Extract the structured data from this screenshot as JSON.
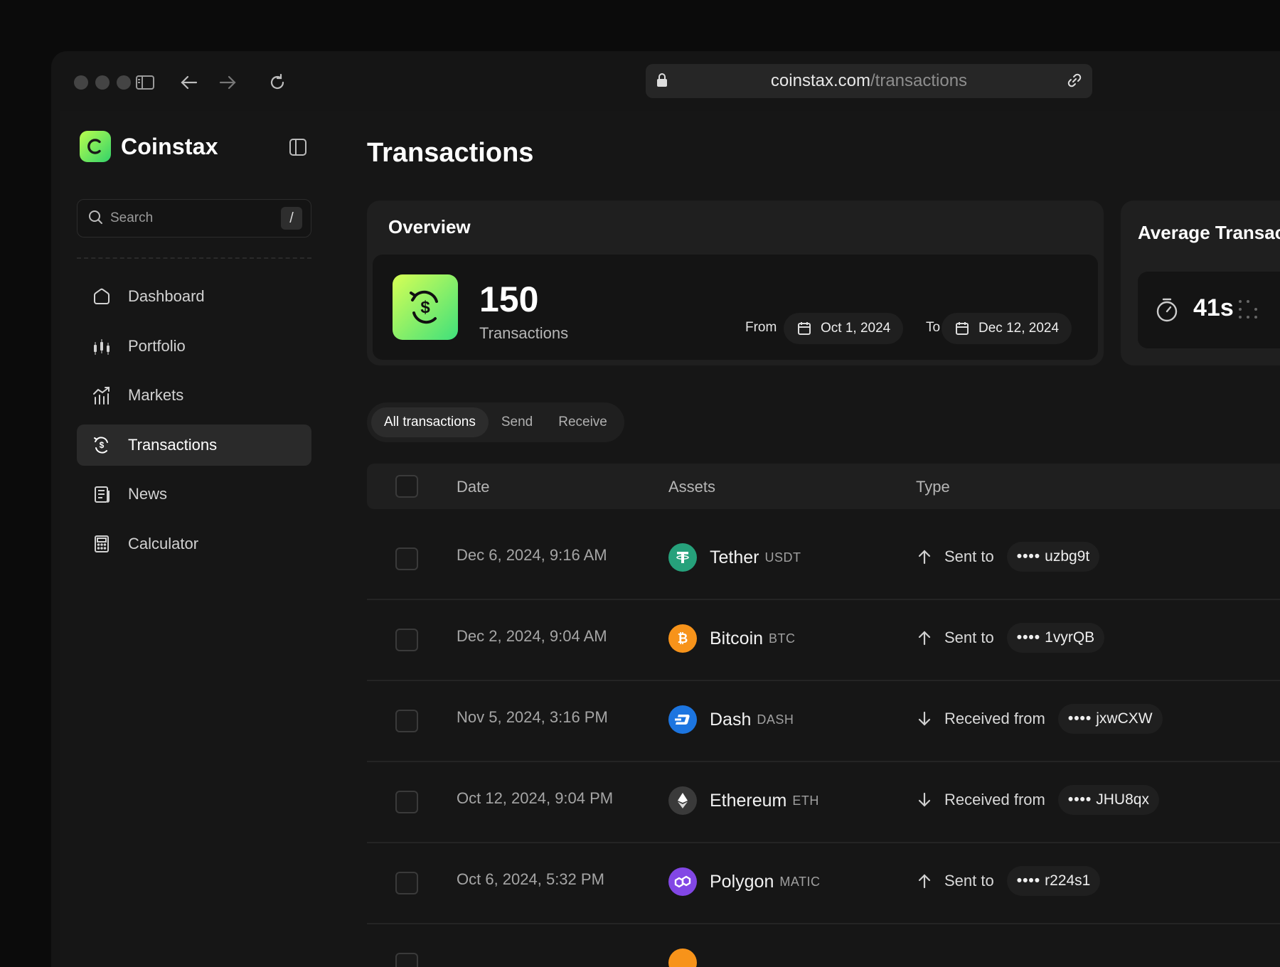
{
  "browser": {
    "url_host": "coinstax.com",
    "url_path": "/transactions"
  },
  "sidebar": {
    "brand": "Coinstax",
    "search_placeholder": "Search",
    "search_shortcut": "/",
    "items": [
      {
        "label": "Dashboard",
        "icon": "home-icon",
        "active": false
      },
      {
        "label": "Portfolio",
        "icon": "portfolio-icon",
        "active": false
      },
      {
        "label": "Markets",
        "icon": "markets-icon",
        "active": false
      },
      {
        "label": "Transactions",
        "icon": "transactions-icon",
        "active": true
      },
      {
        "label": "News",
        "icon": "news-icon",
        "active": false
      },
      {
        "label": "Calculator",
        "icon": "calculator-icon",
        "active": false
      }
    ]
  },
  "main": {
    "title": "Transactions",
    "overview": {
      "title": "Overview",
      "count": "150",
      "count_label": "Transactions",
      "from_label": "From",
      "from_date": "Oct 1, 2024",
      "to_label": "To",
      "to_date": "Dec 12, 2024"
    },
    "avg_card": {
      "title": "Average Transac",
      "value": "41s"
    },
    "tabs": [
      {
        "label": "All transactions",
        "active": true
      },
      {
        "label": "Send",
        "active": false
      },
      {
        "label": "Receive",
        "active": false
      }
    ],
    "table": {
      "headers": [
        "Date",
        "Assets",
        "Type"
      ],
      "rows": [
        {
          "date": "Dec 6, 2024, 9:16 AM",
          "asset": "Tether",
          "symbol": "USDT",
          "coin_color": "#26a17b",
          "direction": "up",
          "type": "Sent to",
          "addr_mask": "••••",
          "addr": "uzbg9t"
        },
        {
          "date": "Dec 2, 2024, 9:04 AM",
          "asset": "Bitcoin",
          "symbol": "BTC",
          "coin_color": "#f7931a",
          "direction": "up",
          "type": "Sent to",
          "addr_mask": "••••",
          "addr": "1vyrQB"
        },
        {
          "date": "Nov 5, 2024, 3:16 PM",
          "asset": "Dash",
          "symbol": "DASH",
          "coin_color": "#1c75e0",
          "direction": "down",
          "type": "Received from",
          "addr_mask": "••••",
          "addr": "jxwCXW"
        },
        {
          "date": "Oct 12, 2024, 9:04 PM",
          "asset": "Ethereum",
          "symbol": "ETH",
          "coin_color": "#3a3a3a",
          "direction": "down",
          "type": "Received from",
          "addr_mask": "••••",
          "addr": "JHU8qx"
        },
        {
          "date": "Oct 6, 2024, 5:32 PM",
          "asset": "Polygon",
          "symbol": "MATIC",
          "coin_color": "#8247e5",
          "direction": "up",
          "type": "Sent to",
          "addr_mask": "••••",
          "addr": "r224s1"
        }
      ]
    }
  }
}
